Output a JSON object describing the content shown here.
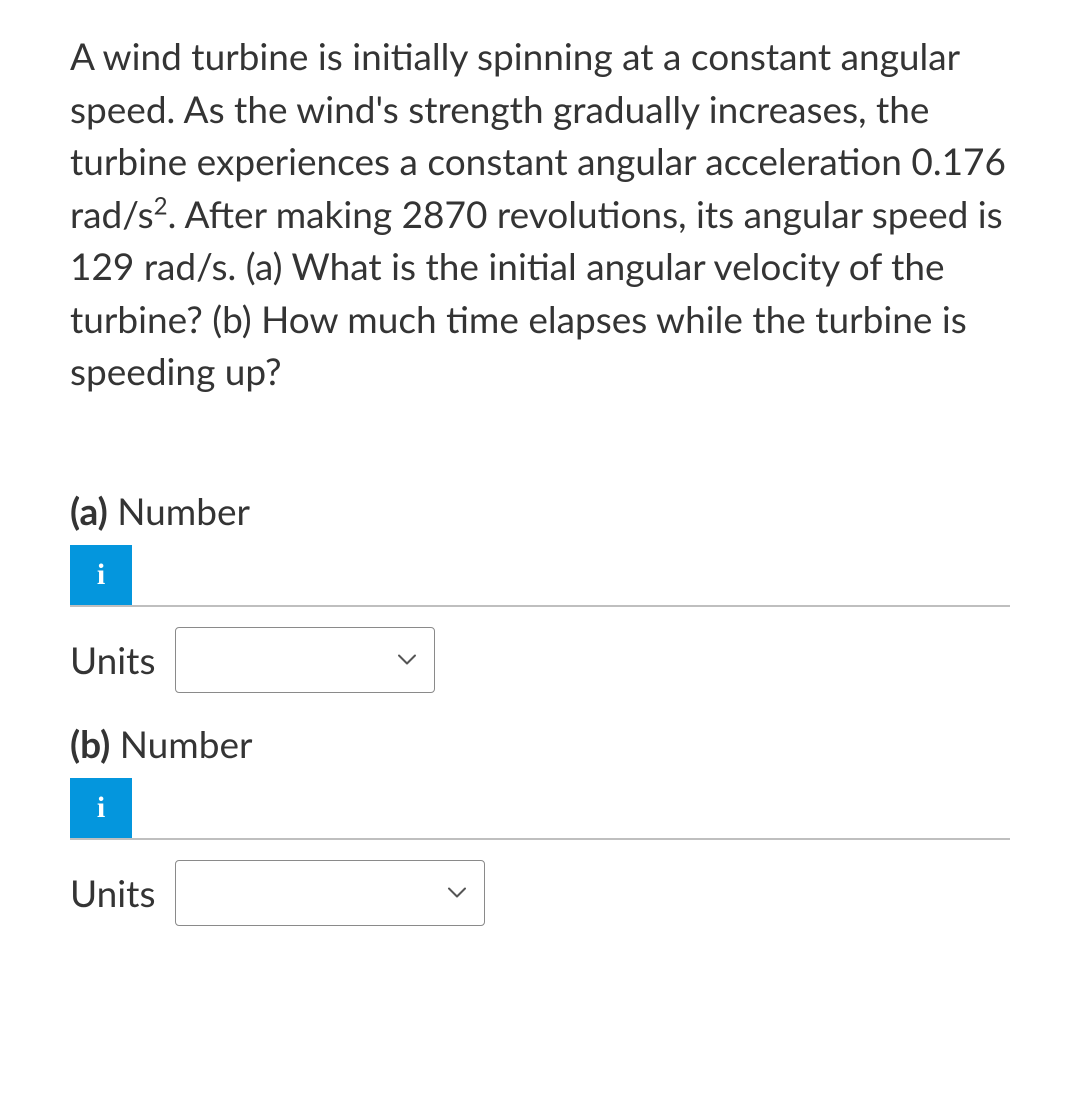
{
  "question": {
    "text_parts": [
      "A wind turbine is initially spinning at a constant angular speed. As the wind's strength gradually increases, the turbine experiences a constant angular acceleration 0.176 rad/s",
      "2",
      ". After making 2870 revolutions, its angular speed is 129 rad/s. (a) What is the initial angular velocity of the turbine? (b) How much time elapses while the turbine is speeding up?"
    ]
  },
  "parts": {
    "a": {
      "prefix": "(a)",
      "label": "Number",
      "info_icon": "i",
      "units_label": "Units",
      "input_value": "",
      "units_value": ""
    },
    "b": {
      "prefix": "(b)",
      "label": "Number",
      "info_icon": "i",
      "units_label": "Units",
      "input_value": "",
      "units_value": ""
    }
  }
}
